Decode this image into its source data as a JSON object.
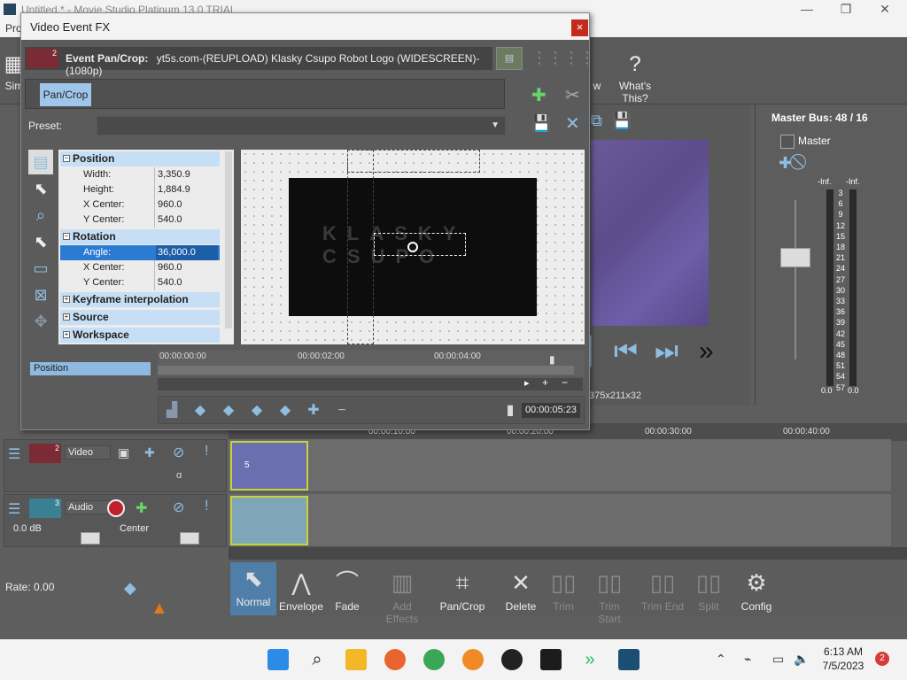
{
  "app": {
    "title": "Untitled * - Movie Studio Platinum 13.0 TRIAL",
    "menu_first": "Pro"
  },
  "toolbar": {
    "whats_this": "What's This?",
    "sim_label": "Sim",
    "w_label": "w"
  },
  "dialog": {
    "title": "Video Event FX",
    "close": "×",
    "event_title": "Event Pan/Crop:",
    "event_source": "yt5s.com-(REUPLOAD) Klasky Csupo Robot Logo (WIDESCREEN)-(1080p)",
    "event_number": "2",
    "chain_button": "Pan/Crop",
    "preset_label": "Preset:",
    "preset_value": ""
  },
  "properties": {
    "position": {
      "label": "Position",
      "rows": [
        {
          "key": "Width:",
          "value": "3,350.9"
        },
        {
          "key": "Height:",
          "value": "1,884.9"
        },
        {
          "key": "X Center:",
          "value": "960.0"
        },
        {
          "key": "Y Center:",
          "value": "540.0"
        }
      ]
    },
    "rotation": {
      "label": "Rotation",
      "rows": [
        {
          "key": "Angle:",
          "value": "36,000.0"
        },
        {
          "key": "X Center:",
          "value": "960.0"
        },
        {
          "key": "Y Center:",
          "value": "540.0"
        }
      ]
    },
    "keyframe_interpolation": "Keyframe interpolation",
    "source": "Source",
    "workspace": "Workspace"
  },
  "canvas": {
    "logo_line1": "KLASKY",
    "logo_line2": "CSUPO"
  },
  "keyframes": {
    "track_label": "Position",
    "ticks": [
      "00:00:00:00",
      "00:00:02:00",
      "00:00:04:00"
    ],
    "time": "00:00:05:23"
  },
  "preview": {
    "status": "375x211x32"
  },
  "master_bus": {
    "title": "Master Bus: 48 / 16",
    "label": "Master",
    "inf_left": "-Inf.",
    "inf_right": "-Inf.",
    "scale": [
      "3",
      "6",
      "9",
      "12",
      "15",
      "18",
      "21",
      "24",
      "27",
      "30",
      "33",
      "36",
      "39",
      "42",
      "45",
      "48",
      "51",
      "54",
      "57"
    ],
    "bottom_left": "0.0",
    "bottom_right": "0.0"
  },
  "timeline": {
    "ticks": [
      "00:00:10:00",
      "00:00:20:00",
      "00:00:30:00",
      "00:00:40:00"
    ],
    "video_track": {
      "number": "2",
      "name": "Video"
    },
    "audio_track": {
      "number": "3",
      "name": "Audio",
      "volume": "0.0 dB",
      "pan": "Center"
    },
    "clip_number": "5"
  },
  "edit_bar": {
    "rate": "Rate: 0.00",
    "buttons": [
      {
        "label": "Normal",
        "icon": "normal-cursor-icon",
        "enabled": true
      },
      {
        "label": "Envelope",
        "icon": "envelope-icon",
        "enabled": true
      },
      {
        "label": "Fade",
        "icon": "fade-icon",
        "enabled": true
      },
      {
        "label": "Add Effects",
        "icon": "add-effects-icon",
        "enabled": false
      },
      {
        "label": "Pan/Crop",
        "icon": "pan-crop-icon",
        "enabled": true
      },
      {
        "label": "Delete",
        "icon": "delete-icon",
        "enabled": true
      },
      {
        "label": "Trim",
        "icon": "trim-icon",
        "enabled": false
      },
      {
        "label": "Trim Start",
        "icon": "trim-start-icon",
        "enabled": false
      },
      {
        "label": "Trim End",
        "icon": "trim-end-icon",
        "enabled": false
      },
      {
        "label": "Split",
        "icon": "split-icon",
        "enabled": false
      },
      {
        "label": "Config",
        "icon": "gear-icon",
        "enabled": true
      }
    ]
  },
  "taskbar": {
    "time": "6:13 AM",
    "date": "7/5/2023",
    "notifications": "2"
  },
  "colors": {
    "accent": "#2c7bd3",
    "section_header": "#c7dff4",
    "clip_border": "#c8d23a",
    "close_red": "#c42b1c"
  }
}
